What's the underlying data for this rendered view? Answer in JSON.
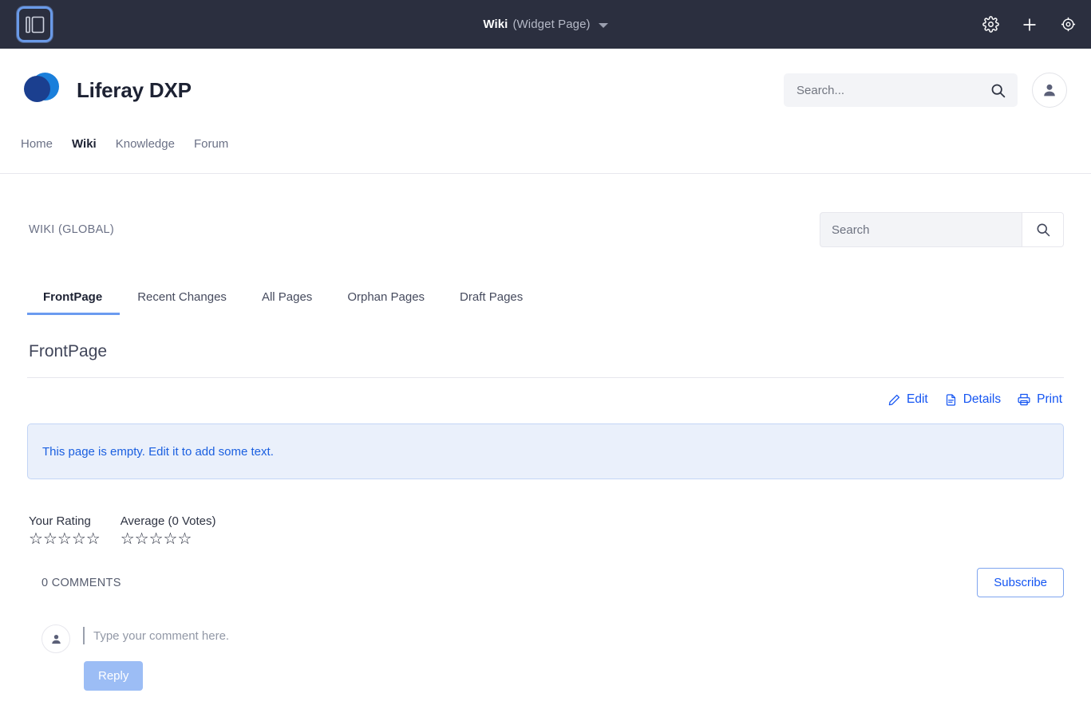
{
  "topbar": {
    "panel_toggle_name": "Toggle side panel",
    "title_main": "Wiki",
    "title_sub": "(Widget Page)",
    "actions": [
      {
        "name": "gear-icon",
        "label": "Settings"
      },
      {
        "name": "plus-icon",
        "label": "Add"
      },
      {
        "name": "globe-icon",
        "label": "Preview"
      }
    ],
    "bg_color": "#2b2f3f",
    "focus_ring_color": "#6a9ae8"
  },
  "site_header": {
    "brand_name": "Liferay DXP",
    "logo": {
      "light": "#1a7fdb",
      "dark": "#1b3f8f"
    },
    "search": {
      "value": "",
      "placeholder": "Search..."
    },
    "nav": [
      {
        "label": "Home",
        "active": false
      },
      {
        "label": "Wiki",
        "active": true
      },
      {
        "label": "Knowledge",
        "active": false
      },
      {
        "label": "Forum",
        "active": false
      }
    ]
  },
  "wiki": {
    "scope_label": "WIKI (GLOBAL)",
    "search": {
      "value": "",
      "placeholder": "Search"
    },
    "tabs": [
      {
        "label": "FrontPage",
        "active": true
      },
      {
        "label": "Recent Changes",
        "active": false
      },
      {
        "label": "All Pages",
        "active": false
      },
      {
        "label": "Orphan Pages",
        "active": false
      },
      {
        "label": "Draft Pages",
        "active": false
      }
    ],
    "page_title": "FrontPage",
    "actions": [
      {
        "label": "Edit",
        "icon": "pencil-icon"
      },
      {
        "label": "Details",
        "icon": "document-icon"
      },
      {
        "label": "Print",
        "icon": "printer-icon"
      }
    ],
    "empty_message": "This page is empty. Edit it to add some text.",
    "accent_color": "#1455f2",
    "tab_underline_color": "#6b9bf0"
  },
  "rating": {
    "your_label": "Your Rating",
    "average_label": "Average (0 Votes)",
    "star_count": 5,
    "your_filled": 0,
    "average_filled": 0,
    "star_empty_glyph": "☆",
    "star_filled_glyph": "★"
  },
  "comments": {
    "count_label": "0 COMMENTS",
    "subscribe_label": "Subscribe",
    "compose_placeholder": "Type your comment here.",
    "compose_value": "",
    "reply_label": "Reply"
  }
}
